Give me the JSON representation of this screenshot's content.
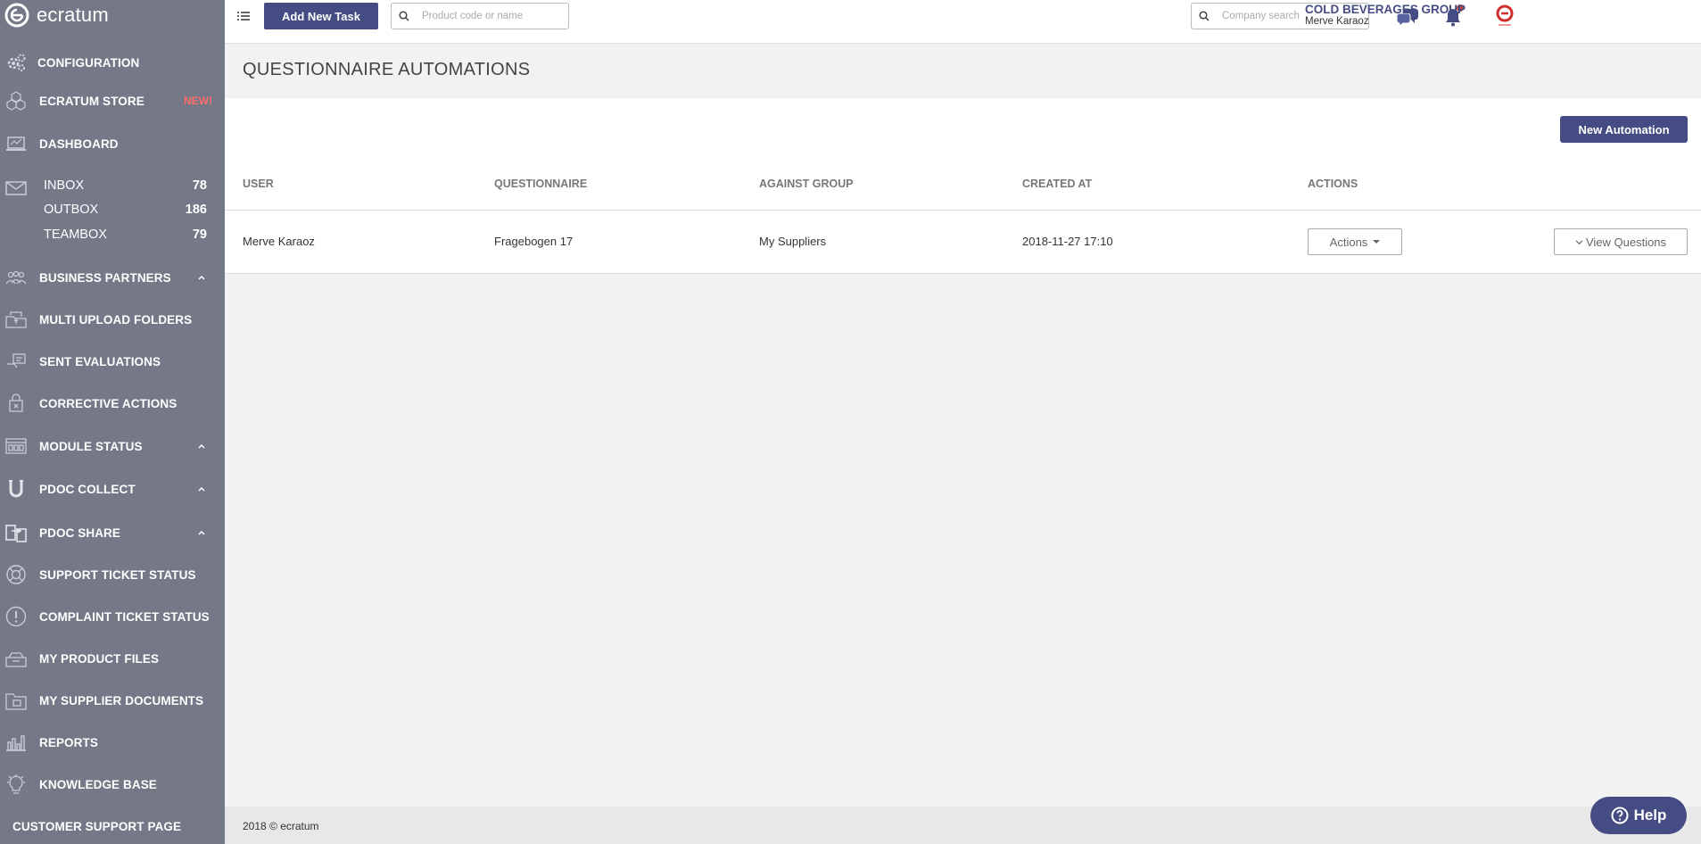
{
  "app": {
    "logo_text": "ecratum"
  },
  "sidebar": {
    "items": [
      {
        "label": "CONFIGURATION",
        "icon": "gears-icon"
      },
      {
        "label": "ECRATUM STORE",
        "badge": "NEW!",
        "icon": "store-cubes-icon"
      },
      {
        "label": "DASHBOARD",
        "icon": "laptop-icon"
      },
      {
        "label": "BUSINESS PARTNERS",
        "icon": "people-group-icon"
      },
      {
        "label": "MULTI UPLOAD FOLDERS",
        "icon": "upload-folder-icon"
      },
      {
        "label": "SENT EVALUATIONS",
        "icon": "evaluation-icon"
      },
      {
        "label": "CORRECTIVE ACTIONS",
        "icon": "lock-box-icon"
      },
      {
        "label": "MODULE STATUS",
        "icon": "module-grid-icon"
      },
      {
        "label": "PDOC COLLECT",
        "icon": "magnet-icon"
      },
      {
        "label": "PDOC SHARE",
        "icon": "share-docs-icon"
      },
      {
        "label": "SUPPORT TICKET STATUS",
        "icon": "lifebuoy-icon"
      },
      {
        "label": "COMPLAINT TICKET STATUS",
        "icon": "exclamation-circle-icon"
      },
      {
        "label": "MY PRODUCT FILES",
        "icon": "product-box-icon"
      },
      {
        "label": "MY SUPPLIER DOCUMENTS",
        "icon": "folder-doc-icon"
      },
      {
        "label": "REPORTS",
        "icon": "bar-chart-icon"
      },
      {
        "label": "KNOWLEDGE BASE",
        "icon": "lightbulb-icon"
      },
      {
        "label": "CUSTOMER SUPPORT PAGE"
      }
    ],
    "mail": [
      {
        "label": "INBOX",
        "count": "78"
      },
      {
        "label": "OUTBOX",
        "count": "186"
      },
      {
        "label": "TEAMBOX",
        "count": "79"
      }
    ]
  },
  "topbar": {
    "add_task_label": "Add New Task",
    "product_search_placeholder": "Product code or name",
    "company_search_placeholder": "Company search",
    "company_name": "COLD BEVERAGES GROUP",
    "user_name": "Merve Karaoz"
  },
  "page": {
    "title": "QUESTIONNAIRE AUTOMATIONS"
  },
  "toolbar": {
    "new_automation_label": "New Automation"
  },
  "table": {
    "headers": [
      "USER",
      "QUESTIONNAIRE",
      "AGAINST GROUP",
      "CREATED AT",
      "ACTIONS"
    ],
    "rows": [
      {
        "user": "Merve Karaoz",
        "questionnaire": "Fragebogen 17",
        "against_group": "My Suppliers",
        "created_at": "2018-11-27 17:10",
        "actions_label": "Actions",
        "view_label": "View Questions"
      }
    ]
  },
  "footer": {
    "text": "2018 © ecratum"
  },
  "help": {
    "label": "Help"
  },
  "colors": {
    "sidebar_bg": "#747887",
    "primary": "#454c84",
    "badge_new": "#ff6b6b",
    "logo_red": "#d0302b"
  }
}
